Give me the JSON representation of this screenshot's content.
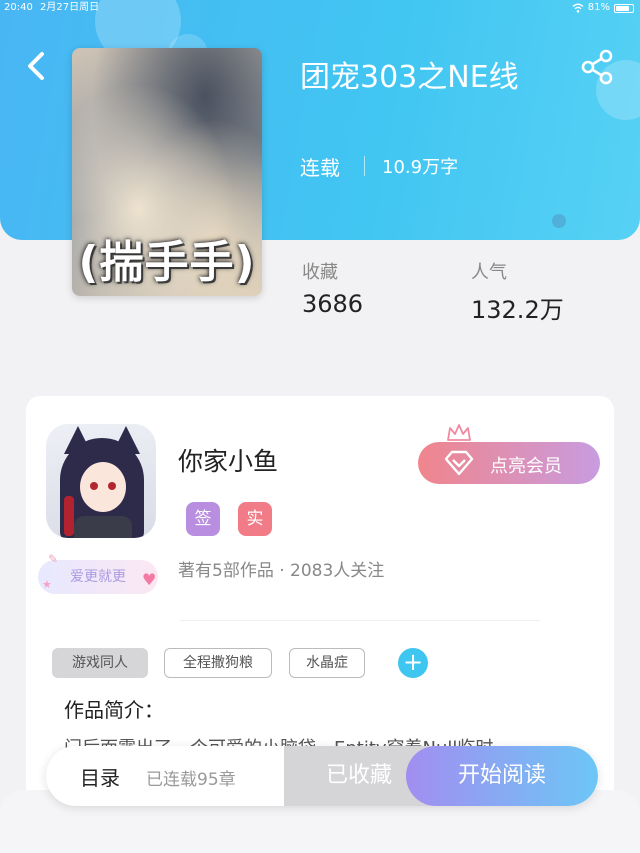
{
  "status_bar": {
    "time": "20:40",
    "date": "2月27日周日",
    "battery": "81%",
    "battery_level": 0.81
  },
  "header": {
    "back_icon": "chevron-left-icon",
    "share_icon": "share-icon"
  },
  "book": {
    "cover_caption": "(揣手手)",
    "title": "团宠303之NE线",
    "status": "连载",
    "word_count": "10.9万字",
    "stats": [
      {
        "label": "收藏",
        "value": "3686"
      },
      {
        "label": "人气",
        "value": "132.2万"
      }
    ]
  },
  "author": {
    "name": "你家小鱼",
    "badge": "爱更就更",
    "tags": [
      {
        "text": "签",
        "color": "#b98ee0"
      },
      {
        "text": "实",
        "color": "#f17b86"
      }
    ],
    "info": "著有5部作品 · 2083人关注",
    "vip_button": "点亮会员",
    "colors": {
      "vip_gradient_start": "#f0858c",
      "vip_gradient_end": "#c89ce0"
    }
  },
  "genre_tags": [
    "游戏同人",
    "全程撒狗粮",
    "水晶症"
  ],
  "intro": {
    "title": "作品简介：",
    "text": "门后面露出了一个可爱的小脑袋。Entity穿着Null临时"
  },
  "bottom_bar": {
    "toc_label": "目录",
    "chapter_count": "已连载95章",
    "favorited_label": "已收藏",
    "read_label": "开始阅读"
  },
  "colors": {
    "header_blue": "#48b6f3",
    "accent_cyan": "#3fc6f0",
    "read_gradient_start": "#a28ef0",
    "read_gradient_end": "#6cc6f6"
  }
}
